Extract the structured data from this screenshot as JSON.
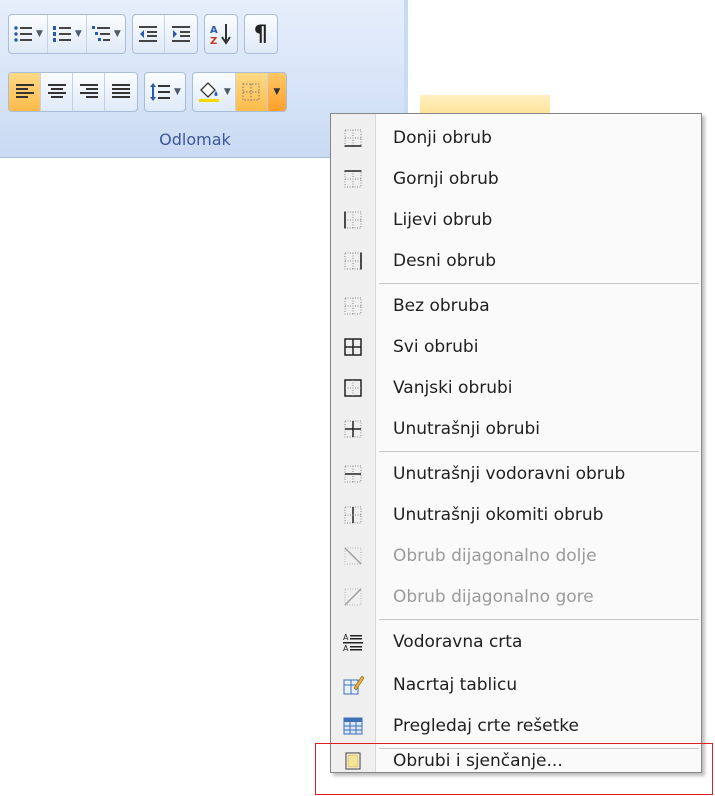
{
  "ribbon": {
    "group_label": "Odlomak",
    "sort_glyph_top": "A",
    "sort_glyph_bottom": "Z",
    "pilcrow": "¶",
    "accent_active": "#ffbb4a"
  },
  "menu": {
    "items": [
      {
        "label": "Donji obrub",
        "icon": "bottom-border-icon",
        "enabled": true
      },
      {
        "label": "Gornji obrub",
        "icon": "top-border-icon",
        "enabled": true
      },
      {
        "label": "Lijevi obrub",
        "icon": "left-border-icon",
        "enabled": true
      },
      {
        "label": "Desni obrub",
        "icon": "right-border-icon",
        "enabled": true
      },
      {
        "label": "Bez obruba",
        "icon": "no-border-icon",
        "enabled": true
      },
      {
        "label": "Svi obrubi",
        "icon": "all-borders-icon",
        "enabled": true
      },
      {
        "label": "Vanjski obrubi",
        "icon": "outside-borders-icon",
        "enabled": true
      },
      {
        "label": "Unutrašnji obrubi",
        "icon": "inside-borders-icon",
        "enabled": true
      },
      {
        "label": "Unutrašnji vodoravni obrub",
        "icon": "inside-horizontal-border-icon",
        "enabled": true
      },
      {
        "label": "Unutrašnji okomiti obrub",
        "icon": "inside-vertical-border-icon",
        "enabled": true
      },
      {
        "label": "Obrub dijagonalno dolje",
        "icon": "diagonal-down-border-icon",
        "enabled": false
      },
      {
        "label": "Obrub dijagonalno gore",
        "icon": "diagonal-up-border-icon",
        "enabled": false
      },
      {
        "label": "Vodoravna crta",
        "icon": "horizontal-line-icon",
        "enabled": true
      },
      {
        "label": "Nacrtaj tablicu",
        "icon": "draw-table-icon",
        "enabled": true
      },
      {
        "label": "Pregledaj crte rešetke",
        "icon": "view-gridlines-icon",
        "enabled": true
      },
      {
        "label": "Obrubi i sjenčanje...",
        "icon": "borders-and-shading-icon",
        "enabled": true,
        "highlighted": true
      }
    ],
    "highlight_color": "#e02020"
  }
}
